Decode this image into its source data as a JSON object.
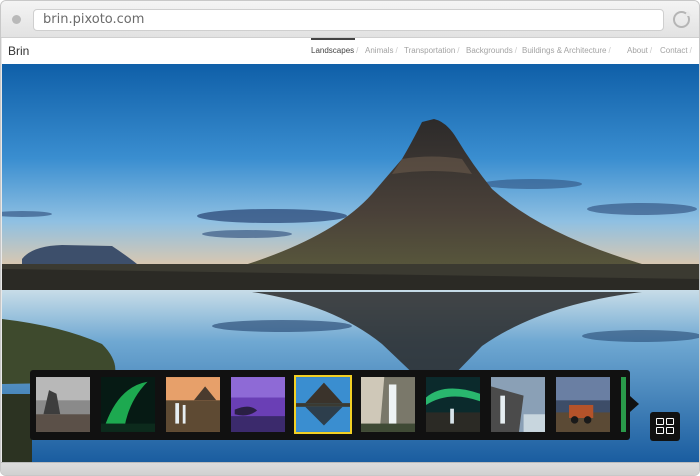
{
  "browser": {
    "url": "brin.pixoto.com",
    "dot_icon": "window-dot-icon",
    "reload_icon": "reload-icon"
  },
  "site": {
    "brand": "Brin",
    "nav": [
      {
        "label": "Landscapes",
        "active": true
      },
      {
        "label": "Animals",
        "active": false
      },
      {
        "label": "Transportation",
        "active": false
      },
      {
        "label": "Backgrounds",
        "active": false
      },
      {
        "label": "Buildings & Architecture",
        "active": false
      },
      {
        "label": "About",
        "active": false
      },
      {
        "label": "Contact",
        "active": false
      }
    ],
    "separator": "/"
  },
  "hero": {
    "subject": "mountain-lake-reflection"
  },
  "thumbnails": {
    "selected_index": 4,
    "items": [
      "sea-stack-beach",
      "green-aurora",
      "waterfalls-sunset",
      "purple-twilight-lake",
      "mountain-lake-reflection",
      "waterfall-gorge",
      "aurora-over-waterfall",
      "coastal-waterfall",
      "rusty-truck-sunset",
      "partial-green"
    ]
  },
  "grid_button": {
    "icon": "grid-view-icon"
  },
  "colors": {
    "active_nav": "#444444",
    "inactive_nav": "#a3a3a3",
    "selection": "#f2d024",
    "strip": "#111111"
  }
}
